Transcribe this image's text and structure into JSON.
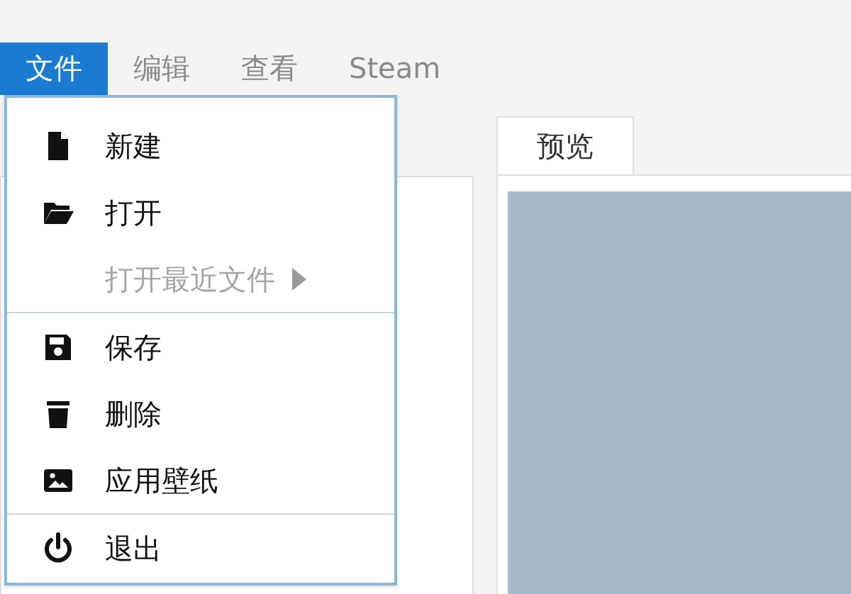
{
  "menubar": [
    {
      "label": "文件",
      "selected": true
    },
    {
      "label": "编辑",
      "selected": false
    },
    {
      "label": "查看",
      "selected": false
    },
    {
      "label": "Steam",
      "selected": false
    }
  ],
  "file_menu": [
    {
      "kind": "item",
      "label": "新建",
      "disabled": false,
      "submenu": false
    },
    {
      "kind": "item",
      "label": "打开",
      "disabled": false,
      "submenu": false
    },
    {
      "kind": "item",
      "label": "打开最近文件",
      "disabled": true,
      "submenu": true
    },
    {
      "kind": "separator"
    },
    {
      "kind": "item",
      "label": "保存",
      "disabled": false,
      "submenu": false
    },
    {
      "kind": "item",
      "label": "删除",
      "disabled": false,
      "submenu": false
    },
    {
      "kind": "item",
      "label": "应用壁纸",
      "disabled": false,
      "submenu": false
    },
    {
      "kind": "separator"
    },
    {
      "kind": "item",
      "label": "退出",
      "disabled": false,
      "submenu": false
    }
  ],
  "preview_tabs": [
    {
      "label": "预览",
      "selected": true
    }
  ]
}
